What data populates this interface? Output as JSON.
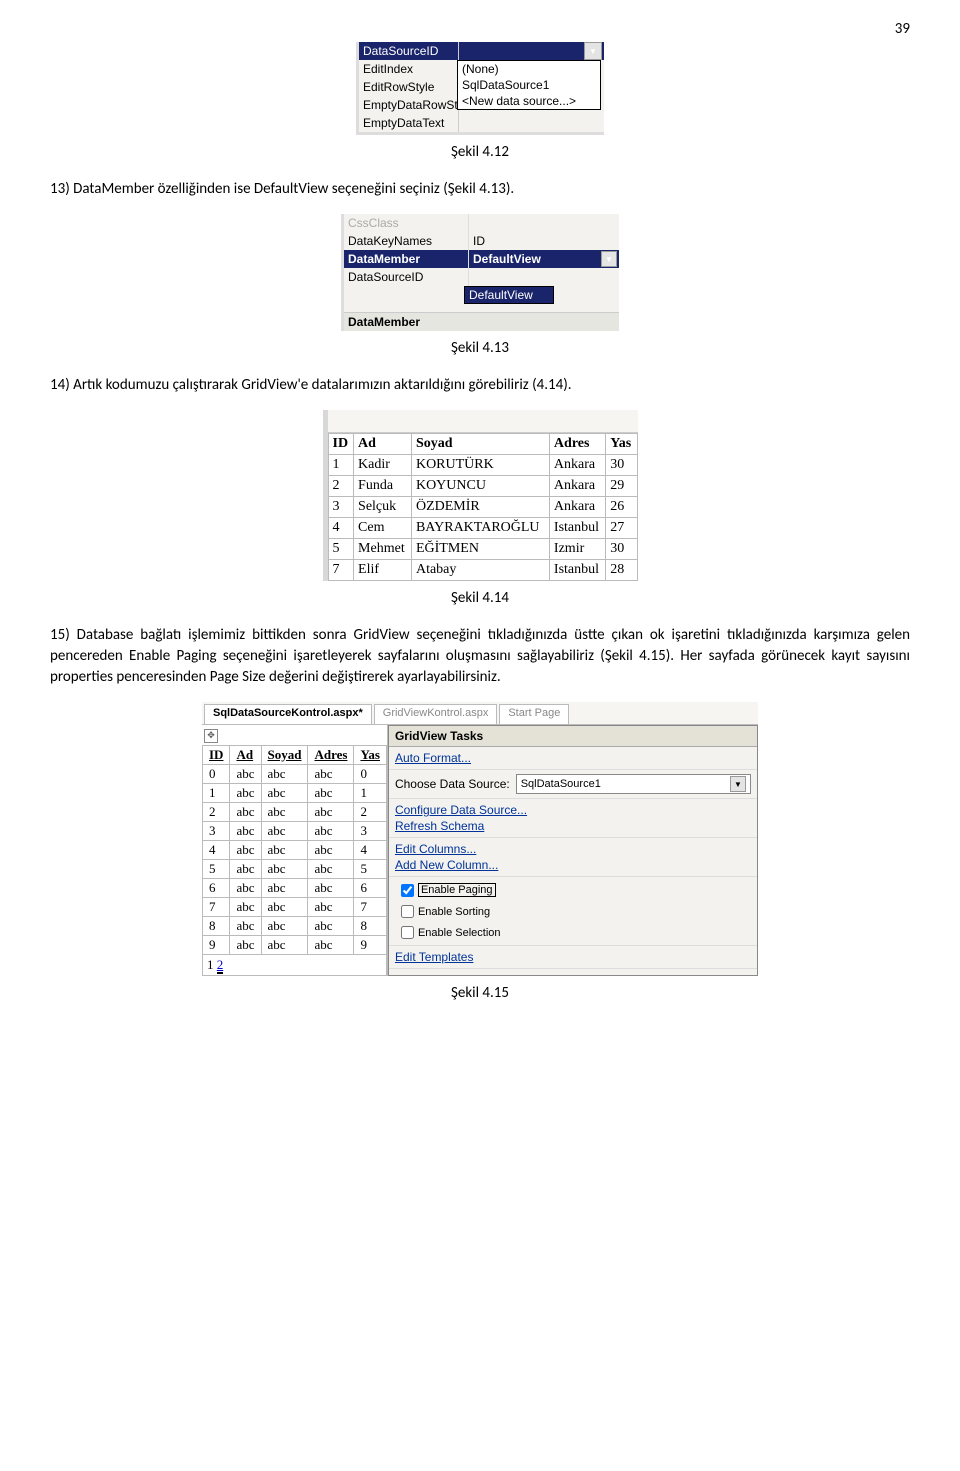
{
  "page_number": "39",
  "captions": {
    "fig412": "Şekil 4.12",
    "fig413": "Şekil 4.13",
    "fig414": "Şekil 4.14",
    "fig415": "Şekil 4.15"
  },
  "paragraphs": {
    "p13": "13) DataMember özelliğinden ise DefaultView seçeneğini seçiniz (Şekil 4.13).",
    "p14": "14) Artık kodumuzu çalıştırarak GridView'e datalarımızın aktarıldığını görebiliriz (4.14).",
    "p15": "15) Database bağlatı işlemimiz bittikden sonra GridView seçeneğini tıkladığınızda üstte çıkan ok işaretini tıkladığınızda karşımıza gelen pencereden Enable Paging seçeneğini işaretleyerek sayfalarını oluşmasını sağlayabiliriz (Şekil 4.15). Her sayfada görünecek kayıt sayısını properties penceresinden Page Size değerini değiştirerek ayarlayabilirsiniz."
  },
  "fig412": {
    "selected": "DataSourceID",
    "rows": [
      "EditIndex",
      "EditRowStyle",
      "EmptyDataRowStyle",
      "EmptyDataText"
    ],
    "options": [
      "(None)",
      "SqlDataSource1",
      "<New data source...>"
    ]
  },
  "fig413": {
    "rows": [
      {
        "l": "CssClass",
        "r": ""
      },
      {
        "l": "DataKeyNames",
        "r": "ID"
      }
    ],
    "selected": {
      "l": "DataMember",
      "r": "DefaultView"
    },
    "after": {
      "l": "DataSourceID",
      "r": ""
    },
    "dropdown_value": "DefaultView",
    "section_label": "DataMember"
  },
  "fig414": {
    "headers": [
      "ID",
      "Ad",
      "Soyad",
      "Adres",
      "Yas"
    ],
    "rows": [
      [
        "1",
        "Kadir",
        "KORUTÜRK",
        "Ankara",
        "30"
      ],
      [
        "2",
        "Funda",
        "KOYUNCU",
        "Ankara",
        "29"
      ],
      [
        "3",
        "Selçuk",
        "ÖZDEMİR",
        "Ankara",
        "26"
      ],
      [
        "4",
        "Cem",
        "BAYRAKTAROĞLU",
        "Istanbul",
        "27"
      ],
      [
        "5",
        "Mehmet",
        "EĞİTMEN",
        "Izmir",
        "30"
      ],
      [
        "7",
        "Elif",
        "Atabay",
        "Istanbul",
        "28"
      ]
    ]
  },
  "fig415": {
    "tabs": [
      "SqlDataSourceKontrol.aspx*",
      "GridViewKontrol.aspx",
      "Start Page"
    ],
    "grid": {
      "headers": [
        "ID",
        "Ad",
        "Soyad",
        "Adres",
        "Yas"
      ],
      "rows": [
        [
          "0",
          "abc",
          "abc",
          "abc",
          "0"
        ],
        [
          "1",
          "abc",
          "abc",
          "abc",
          "1"
        ],
        [
          "2",
          "abc",
          "abc",
          "abc",
          "2"
        ],
        [
          "3",
          "abc",
          "abc",
          "abc",
          "3"
        ],
        [
          "4",
          "abc",
          "abc",
          "abc",
          "4"
        ],
        [
          "5",
          "abc",
          "abc",
          "abc",
          "5"
        ],
        [
          "6",
          "abc",
          "abc",
          "abc",
          "6"
        ],
        [
          "7",
          "abc",
          "abc",
          "abc",
          "7"
        ],
        [
          "8",
          "abc",
          "abc",
          "abc",
          "8"
        ],
        [
          "9",
          "abc",
          "abc",
          "abc",
          "9"
        ]
      ],
      "pager_current": "1",
      "pager_next": "2"
    },
    "tasks": {
      "title": "GridView Tasks",
      "auto_format": "Auto Format...",
      "choose_ds_label": "Choose Data Source:",
      "choose_ds_value": "SqlDataSource1",
      "configure_ds": "Configure Data Source...",
      "refresh_schema": "Refresh Schema",
      "edit_columns": "Edit Columns...",
      "add_new_column": "Add New Column...",
      "enable_paging": "Enable Paging",
      "enable_sorting": "Enable Sorting",
      "enable_selection": "Enable Selection",
      "edit_templates": "Edit Templates"
    }
  }
}
